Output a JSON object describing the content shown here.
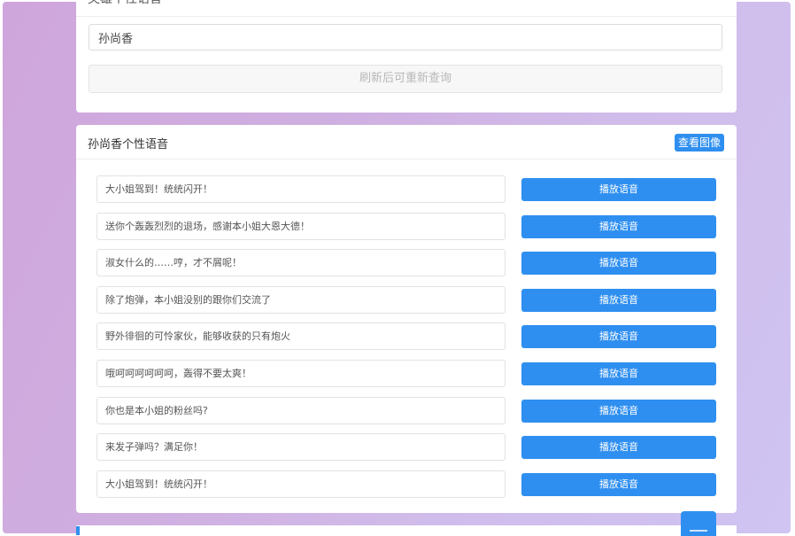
{
  "top_card": {
    "title": "英雄个性语音",
    "name_value": "孙尚香",
    "refresh_label": "刷新后可重新查询"
  },
  "main_card": {
    "title": "孙尚香个性语音",
    "view_image_label": "查看图像",
    "voices": [
      {
        "text": "大小姐驾到！统统闪开！",
        "play_label": "播放语音"
      },
      {
        "text": "送你个轰轰烈烈的退场，感谢本小姐大恩大德！",
        "play_label": "播放语音"
      },
      {
        "text": "淑女什么的……哼，才不屑呢！",
        "play_label": "播放语音"
      },
      {
        "text": "除了炮弹，本小姐没别的跟你们交流了",
        "play_label": "播放语音"
      },
      {
        "text": "野外徘徊的可怜家伙，能够收获的只有炮火",
        "play_label": "播放语音"
      },
      {
        "text": "哦呵呵呵呵呵呵，轰得不要太爽！",
        "play_label": "播放语音"
      },
      {
        "text": "你也是本小姐的粉丝吗?",
        "play_label": "播放语音"
      },
      {
        "text": "来发子弹吗？满足你！",
        "play_label": "播放语音"
      },
      {
        "text": "大小姐驾到！统统闪开！",
        "play_label": "播放语音"
      }
    ]
  },
  "colors": {
    "primary": "#2f8ff0",
    "background_start": "#cfa6dc",
    "background_end": "#cfc4f2"
  }
}
